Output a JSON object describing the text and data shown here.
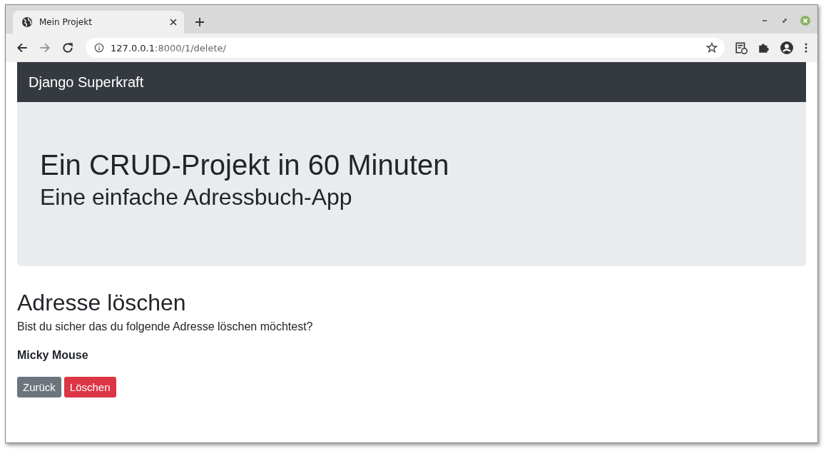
{
  "browser": {
    "tabs": [
      {
        "title": "Mein Projekt",
        "selected": true
      }
    ],
    "url_host": "127.0.0.1",
    "url_path": ":8000/1/delete/"
  },
  "navbar": {
    "brand": "Django Superkraft"
  },
  "jumbotron": {
    "title": "Ein CRUD-Projekt in 60 Minuten",
    "subtitle": "Eine einfache Adressbuch-App"
  },
  "content": {
    "heading": "Adresse löschen",
    "question": "Bist du sicher das du folgende Adresse löschen möchtest?",
    "name": "Micky Mouse",
    "buttons": [
      {
        "label": "Zurück",
        "kind": "secondary"
      },
      {
        "label": "Löschen",
        "kind": "danger"
      }
    ]
  }
}
